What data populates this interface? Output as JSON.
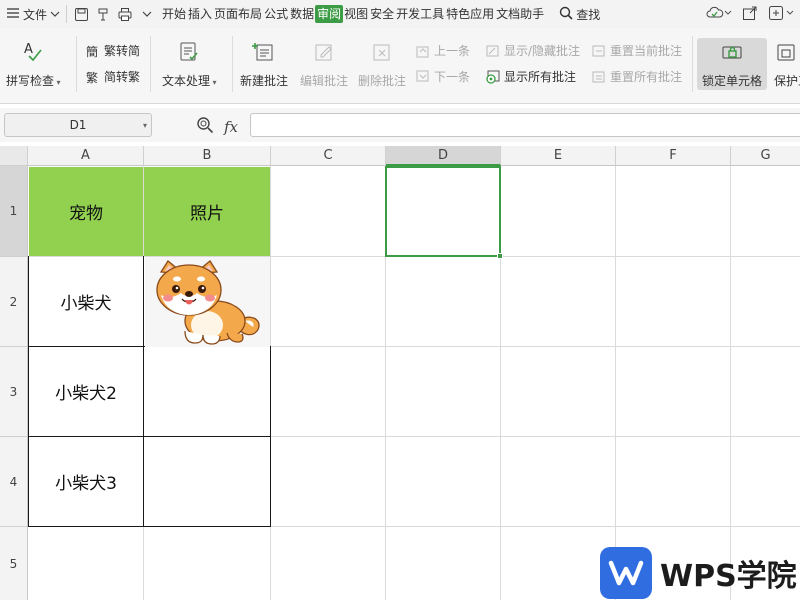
{
  "menubar": {
    "file_label": "文件",
    "tabs": [
      "开始",
      "插入",
      "页面布局",
      "公式",
      "数据",
      "审阅",
      "视图",
      "安全",
      "开发工具",
      "特色应用",
      "文档助手"
    ],
    "active_tab": "审阅",
    "search_label": "查找"
  },
  "ribbon": {
    "spell_check": "拼写检查",
    "trad_to_simp": "繁转简",
    "simp_to_trad": "简转繁",
    "text_process": "文本处理",
    "new_comment": "新建批注",
    "edit_comment": "编辑批注",
    "delete_comment": "删除批注",
    "prev_comment": "上一条",
    "next_comment": "下一条",
    "show_hide_comment": "显示/隐藏批注",
    "show_all_comments": "显示所有批注",
    "reset_current_comment": "重置当前批注",
    "reset_all_comments": "重置所有批注",
    "lock_cell": "锁定单元格",
    "protect": "保护工"
  },
  "formula_bar": {
    "name_box": "D1",
    "fx_label": "fx",
    "formula_value": ""
  },
  "columns": [
    "A",
    "B",
    "C",
    "D",
    "E",
    "F",
    "G"
  ],
  "selected_column": "D",
  "rows": [
    "1",
    "2",
    "3",
    "4",
    "5"
  ],
  "selected_row": "1",
  "table": {
    "header_pet": "宠物",
    "header_photo": "照片",
    "row2_name": "小柴犬",
    "row3_name": "小柴犬2",
    "row4_name": "小柴犬3"
  },
  "watermark": {
    "text": "WPS学院"
  },
  "colors": {
    "header_fill": "#92d050",
    "active_tab": "#3c9c45",
    "selection": "#3c9c45",
    "wps_blue": "#2f6de1"
  }
}
